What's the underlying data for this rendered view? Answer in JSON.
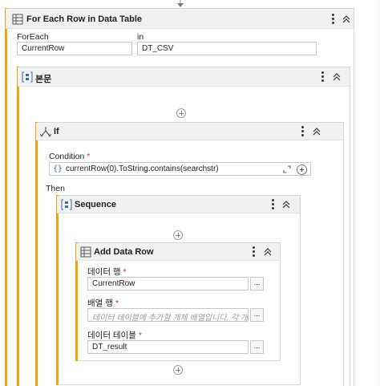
{
  "foreach_activity": {
    "title": "For Each Row in Data Table",
    "foreach_label": "ForEach",
    "foreach_value": "CurrentRow",
    "in_label": "in",
    "in_value": "DT_CSV"
  },
  "body_activity": {
    "title": "본문"
  },
  "if_activity": {
    "title": "If",
    "condition_label": "Condition",
    "condition_required": "*",
    "condition_value": "currentRow(0).ToString.contains(searchstr)",
    "then_label": "Then"
  },
  "sequence_activity": {
    "title": "Sequence"
  },
  "add_data_row": {
    "title": "Add Data Row",
    "data_row_label": "데이터 행",
    "data_row_value": "CurrentRow",
    "array_row_label": "배열 행",
    "array_row_placeholder": "데이터 테이블에 추가할 개체 배열입니다. 각 개",
    "data_table_label": "데이터 테이블",
    "data_table_value": "DT_result",
    "required_mark": "*",
    "browse_label": "..."
  },
  "colors": {
    "accent_stripe": "#f0a30a",
    "header_bg": "#f1f1f1",
    "icon_blue": "#3a6ea5"
  },
  "icons": [
    "arrow-down-icon",
    "table-icon",
    "sequence-icon",
    "if-branch-icon",
    "kebab-menu-icon",
    "collapse-icon",
    "add-icon",
    "expand-icon"
  ]
}
